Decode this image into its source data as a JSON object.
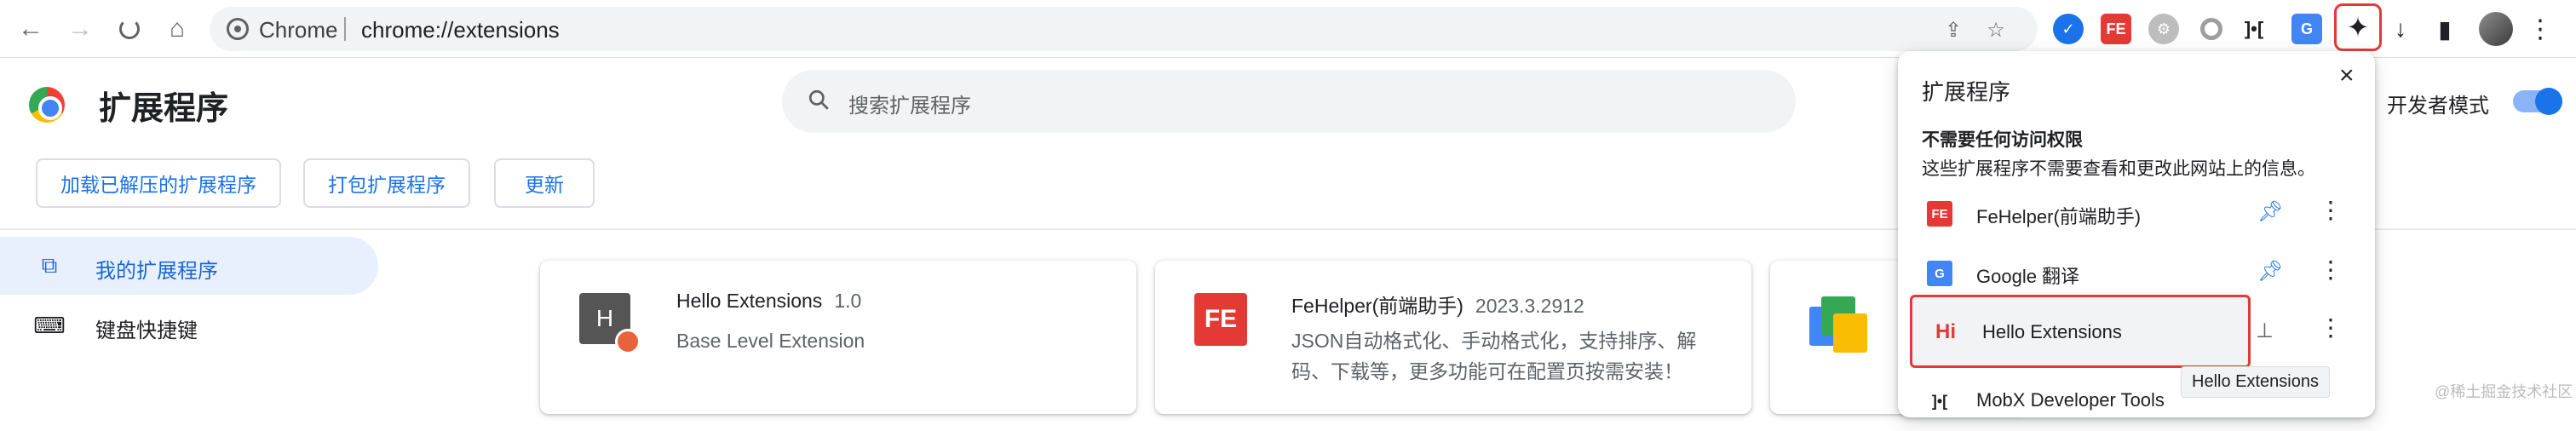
{
  "browser": {
    "omnibox_chip": "Chrome",
    "url": "chrome://extensions",
    "nav": {
      "back": "←",
      "forward": "→",
      "reload": "C",
      "home": "⌂"
    },
    "toolbar_extensions": [
      {
        "name": "icon-1",
        "label": "✓",
        "color": "#1a73e8"
      },
      {
        "name": "fehelper",
        "label": "FE",
        "color": "#e53935"
      },
      {
        "name": "icon-3",
        "label": "⚙",
        "color": "#9e9e9e"
      },
      {
        "name": "icon-4",
        "label": "◎",
        "color": "#757575"
      },
      {
        "name": "mobx",
        "label": "]•[",
        "color": "#202124"
      },
      {
        "name": "google-translate",
        "label": "G",
        "color": "#4285f4"
      }
    ],
    "puzzle_icon": "✦",
    "download_icon": "↓",
    "sidepanel_icon": "▮",
    "menu_icon": "⋮"
  },
  "header": {
    "title": "扩展程序",
    "search_placeholder": "搜索扩展程序",
    "dev_mode_label": "开发者模式",
    "dev_mode_on": true
  },
  "actions": {
    "load_unpacked": "加载已解压的扩展程序",
    "pack": "打包扩展程序",
    "update": "更新"
  },
  "sidebar": {
    "items": [
      {
        "label": "我的扩展程序",
        "icon": "extension-icon",
        "active": true
      },
      {
        "label": "键盘快捷键",
        "icon": "keyboard-icon",
        "active": false
      }
    ]
  },
  "cards": [
    {
      "name": "Hello Extensions",
      "version": "1.0",
      "desc": [
        "Base Level Extension"
      ],
      "icon_text": "H",
      "icon_color": "#555555"
    },
    {
      "name": "FeHelper(前端助手)",
      "version": "2023.3.2912",
      "desc": [
        "JSON自动格式化、手动格式化，支持排序、解",
        "码、下载等，更多功能可在配置页按需安装！"
      ],
      "icon_text": "FE",
      "icon_color": "#e53935"
    }
  ],
  "popup": {
    "title": "扩展程序",
    "close": "×",
    "section": "不需要任何访问权限",
    "desc": "这些扩展程序不需要查看和更改此网站上的信息。",
    "items": [
      {
        "name": "FeHelper(前端助手)",
        "icon": "FE",
        "icon_color": "#e53935",
        "pinned": true
      },
      {
        "name": "Google 翻译",
        "icon": "G",
        "icon_color": "#4285f4",
        "pinned": true
      },
      {
        "name": "Hello Extensions",
        "icon": "Hi",
        "icon_color": "#e53935",
        "pinned": false,
        "selected": true
      },
      {
        "name": "MobX Developer Tools",
        "icon": "]•[",
        "icon_color": "#202124",
        "pinned": false
      }
    ],
    "tooltip": "Hello Extensions"
  },
  "watermark": "@稀土掘金技术社区"
}
